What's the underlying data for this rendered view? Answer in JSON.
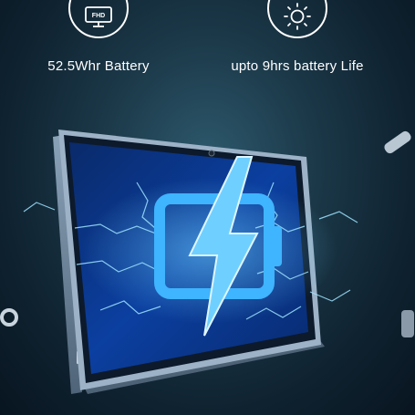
{
  "features": [
    {
      "icon": "fhd-monitor-icon",
      "label": "52.5Whr Battery",
      "icon_text": "FHD"
    },
    {
      "icon": "sun-icon",
      "label": "upto 9hrs battery Life"
    }
  ],
  "colors": {
    "accent": "#3fb4ff",
    "bolt": "#6fd0ff",
    "background_dark": "#0f2230",
    "text": "#ffffff"
  }
}
